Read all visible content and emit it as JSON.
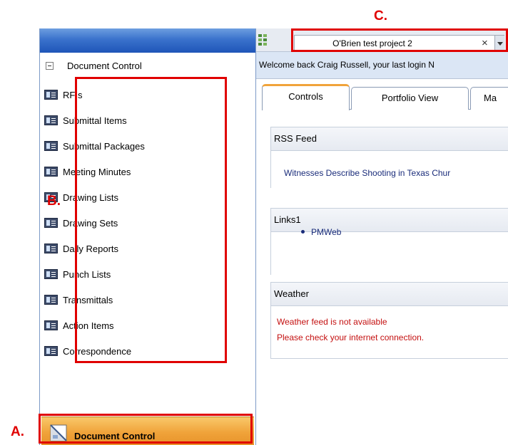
{
  "annotations": {
    "a": "A.",
    "b": "B.",
    "c": "C."
  },
  "sidebar": {
    "root_label": "Document Control",
    "items": [
      {
        "label": "RFIs"
      },
      {
        "label": "Submittal Items"
      },
      {
        "label": "Submittal Packages"
      },
      {
        "label": "Meeting Minutes"
      },
      {
        "label": "Drawing Lists"
      },
      {
        "label": "Drawing Sets"
      },
      {
        "label": "Daily Reports"
      },
      {
        "label": "Punch Lists"
      },
      {
        "label": "Transmittals"
      },
      {
        "label": "Action Items"
      },
      {
        "label": "Correspondence"
      }
    ],
    "footer_label": "Document Control"
  },
  "header": {
    "project_name": "O'Brien test project 2",
    "clear_glyph": "×"
  },
  "welcome": {
    "text": "Welcome back  Craig Russell, your last login N"
  },
  "tabs": [
    {
      "label": "Controls"
    },
    {
      "label": "Portfolio View"
    },
    {
      "label": "Ma"
    }
  ],
  "widgets": {
    "rss": {
      "title": "RSS Feed",
      "link": "Witnesses Describe Shooting in Texas Chur"
    },
    "links": {
      "title": "Links1",
      "item": "PMWeb"
    },
    "weather": {
      "title": "Weather",
      "line1": "Weather feed is not available",
      "line2": "Please check your internet connection."
    }
  },
  "colors": {
    "callout_red": "#e00000",
    "header_blue": "#1f55b8",
    "footer_orange": "#f0a33a",
    "link_navy": "#1a2c7a",
    "error_red": "#c41010"
  },
  "icons": {
    "tree_toggle": "collapse-icon",
    "tree_item": "form-icon",
    "footer": "document-control-icon",
    "combo_clear": "close-icon",
    "combo_dropdown": "chevron-down-icon",
    "grip": "grip-icon"
  }
}
